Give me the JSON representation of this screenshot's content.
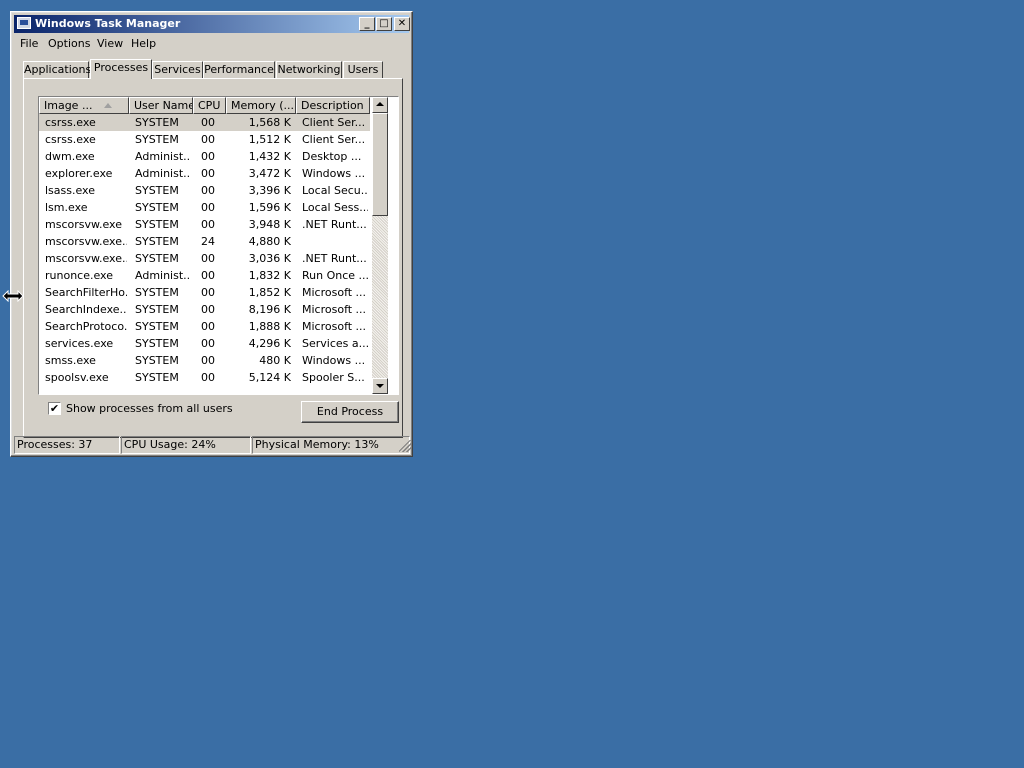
{
  "window": {
    "title": "Windows Task Manager"
  },
  "menu": [
    "File",
    "Options",
    "View",
    "Help"
  ],
  "tabs": [
    {
      "label": "Applications",
      "active": false
    },
    {
      "label": "Processes",
      "active": true
    },
    {
      "label": "Services",
      "active": false
    },
    {
      "label": "Performance",
      "active": false
    },
    {
      "label": "Networking",
      "active": false
    },
    {
      "label": "Users",
      "active": false
    }
  ],
  "columns": [
    "Image ...",
    "User Name",
    "CPU",
    "Memory (...",
    "Description"
  ],
  "sort": {
    "column": "Image ...",
    "direction": "ascending"
  },
  "processes": [
    [
      "csrss.exe",
      "SYSTEM",
      "00",
      "1,568 K",
      "Client Ser..."
    ],
    [
      "csrss.exe",
      "SYSTEM",
      "00",
      "1,512 K",
      "Client Ser..."
    ],
    [
      "dwm.exe",
      "Administ...",
      "00",
      "1,432 K",
      "Desktop ..."
    ],
    [
      "explorer.exe",
      "Administ...",
      "00",
      "3,472 K",
      "Windows ..."
    ],
    [
      "lsass.exe",
      "SYSTEM",
      "00",
      "3,396 K",
      "Local Secu..."
    ],
    [
      "lsm.exe",
      "SYSTEM",
      "00",
      "1,596 K",
      "Local Sess..."
    ],
    [
      "mscorsvw.exe",
      "SYSTEM",
      "00",
      "3,948 K",
      ".NET Runt..."
    ],
    [
      "mscorsvw.exe...",
      "SYSTEM",
      "24",
      "4,880 K",
      ""
    ],
    [
      "mscorsvw.exe...",
      "SYSTEM",
      "00",
      "3,036 K",
      ".NET Runt..."
    ],
    [
      "runonce.exe",
      "Administ...",
      "00",
      "1,832 K",
      "Run Once ..."
    ],
    [
      "SearchFilterHo...",
      "SYSTEM",
      "00",
      "1,852 K",
      "Microsoft ..."
    ],
    [
      "SearchIndexe...",
      "SYSTEM",
      "00",
      "8,196 K",
      "Microsoft ..."
    ],
    [
      "SearchProtoco...",
      "SYSTEM",
      "00",
      "1,888 K",
      "Microsoft ..."
    ],
    [
      "services.exe",
      "SYSTEM",
      "00",
      "4,296 K",
      "Services a..."
    ],
    [
      "smss.exe",
      "SYSTEM",
      "00",
      "480 K",
      "Windows ..."
    ],
    [
      "spoolsv.exe",
      "SYSTEM",
      "00",
      "5,124 K",
      "Spooler S..."
    ]
  ],
  "selected_row": 0,
  "show_all": {
    "label": "Show processes from all users",
    "checked": true,
    "mark": "✔"
  },
  "end_process": "End Process",
  "status": {
    "processes": "Processes: 37",
    "cpu": "CPU Usage: 24%",
    "memory": "Physical Memory: 13%"
  },
  "colors": {
    "desktop": "#3a6ea5",
    "titlebar_start": "#0a246a",
    "titlebar_end": "#a6caf0",
    "face": "#d4d0c8"
  }
}
